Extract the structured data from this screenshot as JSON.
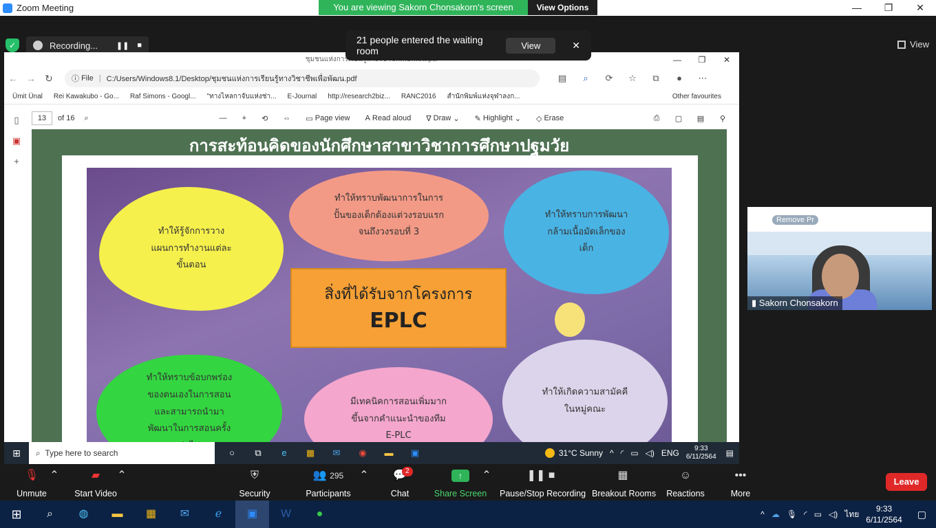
{
  "zoom": {
    "window_title": "Zoom Meeting",
    "viewing_banner": "You are viewing Sakorn  Chonsakorn's screen",
    "view_options": "View Options",
    "recording_label": "Recording...",
    "view_label": "View",
    "waiting_room": {
      "message": "21 people entered the waiting room",
      "view_button": "View"
    },
    "video": {
      "participant_name": "Sakorn  Chonsakorn",
      "remove_label": "Remove Pr"
    },
    "toolbar": {
      "unmute": "Unmute",
      "start_video": "Start Video",
      "security": "Security",
      "participants": "Participants",
      "participants_count": "295",
      "chat": "Chat",
      "chat_badge": "2",
      "share_screen": "Share Screen",
      "pause_recording": "Pause/Stop Recording",
      "breakout": "Breakout Rooms",
      "reactions": "Reactions",
      "more": "More",
      "leave": "Leave"
    }
  },
  "browser": {
    "tab_title": "ชุมชนแห่งการเรียนรู้ทางวิชาชีพเพื่อพัฒน.pdf",
    "address_label": "File",
    "address": "C:/Users/Windows8.1/Desktop/ชุมชนแห่งการเรียนรู้ทางวิชาชีพเพื่อพัฒน.pdf",
    "favourites": [
      "Ümit Ünal",
      "Rei Kawakubo - Go...",
      "Raf Simons - Googl...",
      "\"ทางไหลกาจับแห่งช่า...",
      "E-Journal",
      "http://research2biz...",
      "RANC2016",
      "สำนักพิมพ์แห่งจุฬาลงก..."
    ],
    "other_favourites": "Other favourites",
    "pdf_toolbar": {
      "page": "13",
      "of": "of 16",
      "page_view": "Page view",
      "read_aloud": "Read aloud",
      "draw": "Draw",
      "highlight": "Highlight",
      "erase": "Erase"
    }
  },
  "slide": {
    "title": "การสะท้อนคิดของนักศึกษาสาขาวิชาการศึกษาปฐมวัย",
    "center_line1": "สิ่งที่ได้รับจากโครงการ",
    "center_line2": "EPLC",
    "cloud_yellow": "ทำให้รู้จักการวาง\nแผนการทำงานแต่ละ\nขั้นตอน",
    "cloud_salmon": "ทำให้ทราบพัฒนาการในการ\nปั้นของเด็กต้องแต่วงรอบแรก\nจนถึงวงรอบที่ 3",
    "cloud_blue": "ทำให้ทราบการพัฒนา\nกล้ามเนื้อมัดเล็กของ\nเด็ก",
    "cloud_green": "ทำให้ทราบข้อบกพร่อง\nของตนเองในการสอน\nและสามารถนำมา\nพัฒนาในการสอนครั้ง\nต่อไป",
    "cloud_pink": "มีเทคนิคการสอนเพิ่มมาก\nขึ้นจากคำแนะนำของทีม\nE-PLC",
    "cloud_lav": "ทำให้เกิดความสามัคคี\nในหมู่คณะ"
  },
  "inner_taskbar": {
    "search_placeholder": "Type here to search",
    "weather": "31°C  Sunny",
    "lang": "ENG",
    "time": "9:33",
    "date": "6/11/2564"
  },
  "host_taskbar": {
    "lang": "ไทย",
    "time": "9:33",
    "date": "6/11/2564"
  },
  "colors": {
    "zoom_green": "#2fb45a",
    "leave_red": "#e02828",
    "slide_bg": "#4e7152"
  }
}
